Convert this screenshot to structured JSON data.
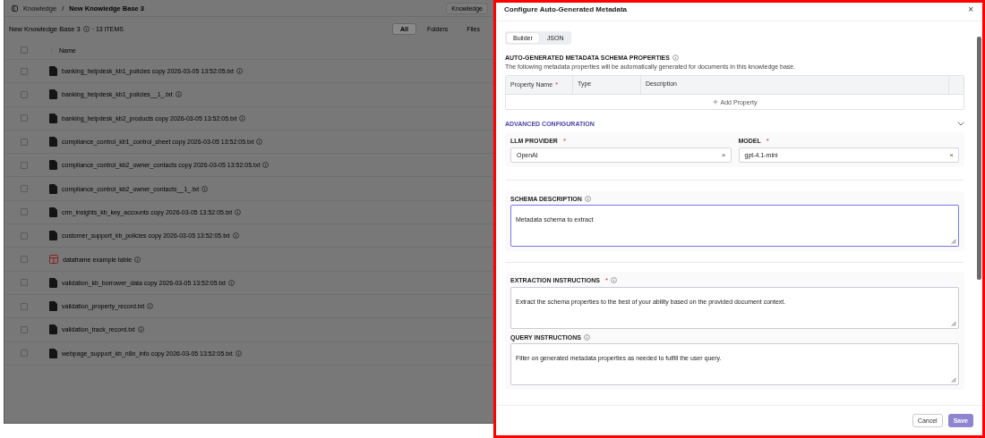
{
  "page": {
    "breadcrumbs": [
      {
        "label": "Knowledge",
        "current": false
      },
      {
        "label": "New Knowledge Base 3",
        "current": true
      }
    ],
    "separator": "/",
    "header_button": "Knowledge",
    "title": "New Knowledge Base 3",
    "count": "· 13 ITEMS",
    "filters": [
      {
        "label": "All",
        "selected": true
      },
      {
        "label": "Folders",
        "selected": false
      },
      {
        "label": "Files",
        "selected": false
      }
    ],
    "select_all_checked": false,
    "column": "Name",
    "rows": [
      {
        "kind": "file",
        "name": "banking_helpdesk_kb1_policies copy 2026-03-05 13:52:05.txt",
        "checked": false
      },
      {
        "kind": "file",
        "name": "banking_helpdesk_kb1_policies__1_.txt",
        "checked": false
      },
      {
        "kind": "file",
        "name": "banking_helpdesk_kb2_products copy 2026-03-05 13:52:05.txt",
        "checked": false
      },
      {
        "kind": "file",
        "name": "compliance_control_kb1_control_sheet copy 2026-03-05 13:52:05.txt",
        "checked": false
      },
      {
        "kind": "file",
        "name": "compliance_control_kb2_owner_contacts copy 2026-03-05 13:52:05.txt",
        "checked": false
      },
      {
        "kind": "file",
        "name": "compliance_control_kb2_owner_contacts__1_.txt",
        "checked": false
      },
      {
        "kind": "file",
        "name": "crm_insights_kb_key_accounts copy 2026-03-05 13:52:05.txt",
        "checked": false
      },
      {
        "kind": "file",
        "name": "customer_support_kb_policies copy 2026-03-05 13:52:05.txt",
        "checked": false
      },
      {
        "kind": "table",
        "name": "dataframe example table",
        "checked": false
      },
      {
        "kind": "file",
        "name": "validation_kb_borrower_data copy 2026-03-05 13:52:05.txt",
        "checked": false
      },
      {
        "kind": "file",
        "name": "validation_property_record.txt",
        "checked": false
      },
      {
        "kind": "file",
        "name": "validation_track_record.txt",
        "checked": false
      },
      {
        "kind": "file",
        "name": "webpage_support_kb_n8n_info copy 2026-03-05 13:52:05.txt",
        "checked": false
      }
    ]
  },
  "dialog": {
    "title": "Configure Auto-Generated Metadata",
    "close": "×",
    "required_mark": "*",
    "clear": "×",
    "tabs": [
      {
        "label": "Builder",
        "selected": true
      },
      {
        "label": "JSON",
        "selected": false
      }
    ],
    "schema_heading": "AUTO-GENERATED METADATA SCHEMA PROPERTIES",
    "schema_text": "The following metadata properties will be automatically generated for documents in this knowledge base.",
    "columns": [
      {
        "label": "Property Name",
        "required": true
      },
      {
        "label": "Type",
        "required": false
      },
      {
        "label": "Description",
        "required": false
      }
    ],
    "add_property": "Add Property",
    "advanced_heading": "ADVANCED CONFIGURATION",
    "advanced_expanded": true,
    "provider": {
      "label": "LLM PROVIDER",
      "required": true,
      "value": "OpenAI"
    },
    "model": {
      "label": "MODEL",
      "required": true,
      "value": "gpt-4.1-mini"
    },
    "schema_description": {
      "label": "SCHEMA DESCRIPTION",
      "value": "Metadata schema to extract",
      "required": false,
      "focused": true
    },
    "extraction": {
      "label": "EXTRACTION INSTRUCTIONS",
      "required": true,
      "value": "Extract the schema properties to the best of your ability based on the provided document context.",
      "focused": false
    },
    "query": {
      "label": "QUERY INSTRUCTIONS",
      "required": false,
      "value": "Filter on generated metadata properties as needed to fulfill the user query.",
      "focused": false
    },
    "cancel": "Cancel",
    "save": {
      "label": "Save",
      "disabled": true
    }
  }
}
